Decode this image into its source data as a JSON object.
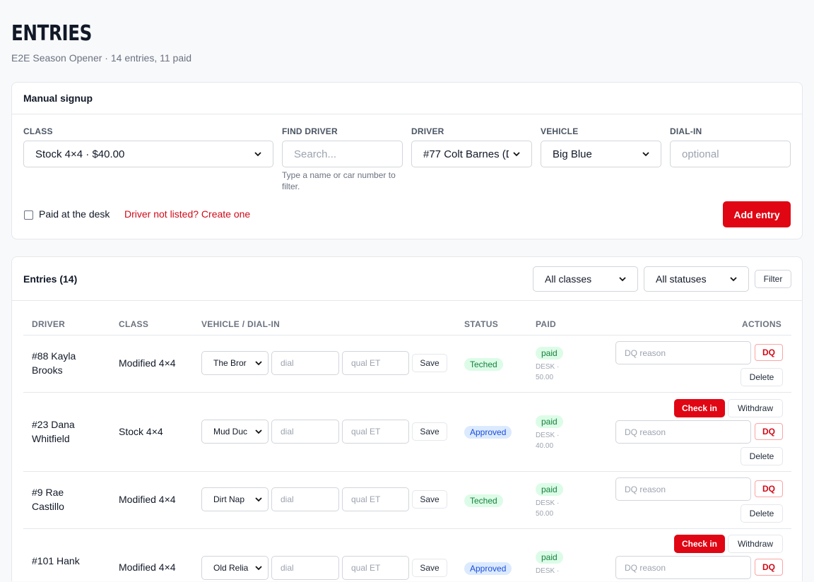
{
  "header": {
    "title": "ENTRIES",
    "subtitle": "E2E Season Opener · 14 entries, 11 paid"
  },
  "signup": {
    "title": "Manual signup",
    "class_label": "CLASS",
    "class_value": "Stock 4×4 · $40.00",
    "find_label": "FIND DRIVER",
    "find_placeholder": "Search...",
    "find_help": "Type a name or car number to filter.",
    "driver_label": "DRIVER",
    "driver_value": "#77 Colt Barnes (D",
    "vehicle_label": "VEHICLE",
    "vehicle_value": "Big Blue",
    "dial_label": "DIAL-IN",
    "dial_placeholder": "optional",
    "paid_label": "Paid at the desk",
    "create_link": "Driver not listed? Create one",
    "add_button": "Add entry"
  },
  "entries": {
    "title": "Entries (14)",
    "class_filter": "All classes",
    "status_filter": "All statuses",
    "filter_button": "Filter",
    "columns": [
      "DRIVER",
      "CLASS",
      "VEHICLE / DIAL-IN",
      "STATUS",
      "PAID",
      "ACTIONS"
    ],
    "dial_placeholder": "dial",
    "qual_placeholder": "qual ET",
    "save_label": "Save",
    "dq_placeholder": "DQ reason",
    "dq_label": "DQ",
    "delete_label": "Delete",
    "checkin_label": "Check in",
    "withdraw_label": "Withdraw",
    "rows": [
      {
        "driver_line1": "#88 Kayla",
        "driver_line2": "Brooks",
        "class": "Modified 4×4",
        "vehicle": "The Bror",
        "status": "Teched",
        "paid": "paid",
        "paid_note": "DESK · 50.00"
      },
      {
        "driver_line1": "#23 Dana",
        "driver_line2": "Whitfield",
        "class": "Stock 4×4",
        "vehicle": "Mud Duc",
        "status": "Approved",
        "paid": "paid",
        "paid_note": "DESK · 40.00"
      },
      {
        "driver_line1": "#9 Rae",
        "driver_line2": "Castillo",
        "class": "Modified 4×4",
        "vehicle": "Dirt Nap",
        "status": "Teched",
        "paid": "paid",
        "paid_note": "DESK · 50.00"
      },
      {
        "driver_line1": "#101 Hank",
        "driver_line2": "",
        "class": "Modified 4×4",
        "vehicle": "Old Relia",
        "status": "Approved",
        "paid": "paid",
        "paid_note": "DESK ·"
      }
    ]
  },
  "colors": {
    "accent_red": "#e00613",
    "teched_bg": "#dcfce7",
    "approved_bg": "#dbeafe"
  }
}
